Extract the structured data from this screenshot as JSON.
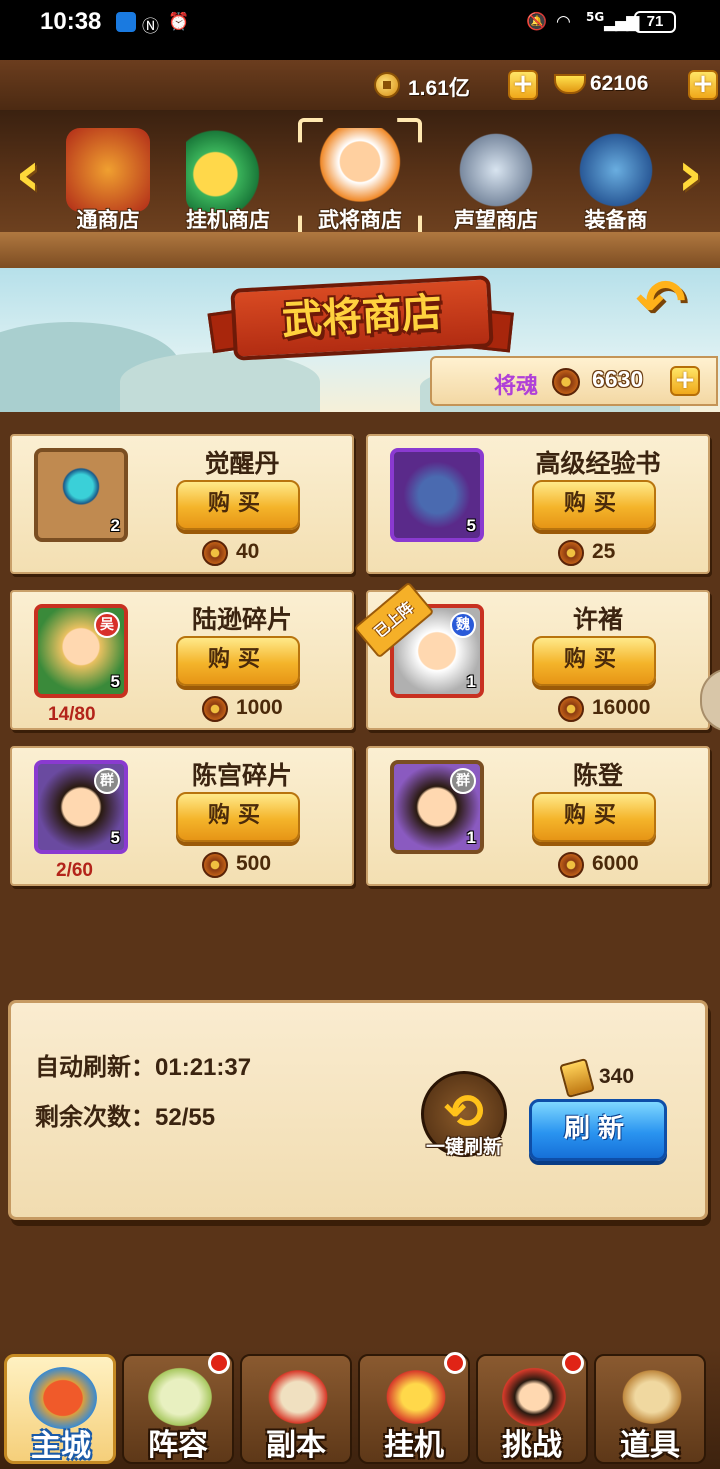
{
  "status_bar": {
    "time": "10:38",
    "network": "5G",
    "battery": "71"
  },
  "currency": {
    "copper": "1.61亿",
    "gold": "62106"
  },
  "shop_tabs": [
    {
      "label": "通商店",
      "icon": "treasure-chest-icon",
      "selected": false
    },
    {
      "label": "挂机商店",
      "icon": "gold-coin-icon",
      "selected": false
    },
    {
      "label": "武将商店",
      "icon": "general-portrait-icon",
      "selected": true
    },
    {
      "label": "声望商店",
      "icon": "armor-icon",
      "selected": false
    },
    {
      "label": "装备商",
      "icon": "robe-icon",
      "selected": false
    }
  ],
  "banner": {
    "title": "武将商店",
    "souls_label": "将魂",
    "souls_value": "6630"
  },
  "items": [
    {
      "name": "觉醒丹",
      "qty": "2",
      "buy_label": "购买",
      "price": "40",
      "icon": "crystal-ball-icon",
      "frame": "#7a4e22",
      "bg": "#8a5a2e"
    },
    {
      "name": "高级经验书",
      "qty": "5",
      "buy_label": "购买",
      "price": "25",
      "icon": "book-icon",
      "frame": "#8a3ad0",
      "bg": "#5a2a8a"
    },
    {
      "name": "陆逊碎片",
      "qty": "5",
      "buy_label": "购买",
      "price": "1000",
      "fragments": "14/80",
      "faction": "吴",
      "faction_color": "#d8302a",
      "icon": "lu-xun-portrait-icon",
      "frame": "#c83020",
      "bg": "#e0a060"
    },
    {
      "name": "许褚",
      "qty": "1",
      "buy_label": "购买",
      "price": "16000",
      "faction": "魏",
      "faction_color": "#2a5ad8",
      "badge": "已上阵",
      "icon": "xu-chu-portrait-icon",
      "frame": "#c83020",
      "bg": "#d8d8d8"
    },
    {
      "name": "陈宫碎片",
      "qty": "5",
      "buy_label": "购买",
      "price": "500",
      "fragments": "2/60",
      "faction": "群",
      "faction_color": "#8a8a8a",
      "icon": "chen-gong-portrait-icon",
      "frame": "#8a3ad0",
      "bg": "#6a4aa0"
    },
    {
      "name": "陈登",
      "qty": "1",
      "buy_label": "购买",
      "price": "6000",
      "faction": "群",
      "faction_color": "#8a8a8a",
      "icon": "chen-deng-portrait-icon",
      "frame": "#7a4e22",
      "bg": "#c08a50"
    }
  ],
  "refresh": {
    "auto_label": "自动刷新：",
    "auto_time": "01:21:37",
    "remaining_label": "剩余次数：",
    "remaining": "52/55",
    "onekey_label": "一键刷新",
    "cost": "340",
    "button_label": "刷新"
  },
  "nav": [
    {
      "label": "主城",
      "icon": "palace-icon",
      "active": true,
      "dot": false
    },
    {
      "label": "阵容",
      "icon": "fan-icon",
      "active": false,
      "dot": true
    },
    {
      "label": "副本",
      "icon": "scroll-map-icon",
      "active": false,
      "dot": false
    },
    {
      "label": "挂机",
      "icon": "treasure-bag-icon",
      "active": false,
      "dot": true
    },
    {
      "label": "挑战",
      "icon": "heroes-challenge-icon",
      "active": false,
      "dot": true
    },
    {
      "label": "道具",
      "icon": "item-bag-icon",
      "active": false,
      "dot": false
    }
  ]
}
